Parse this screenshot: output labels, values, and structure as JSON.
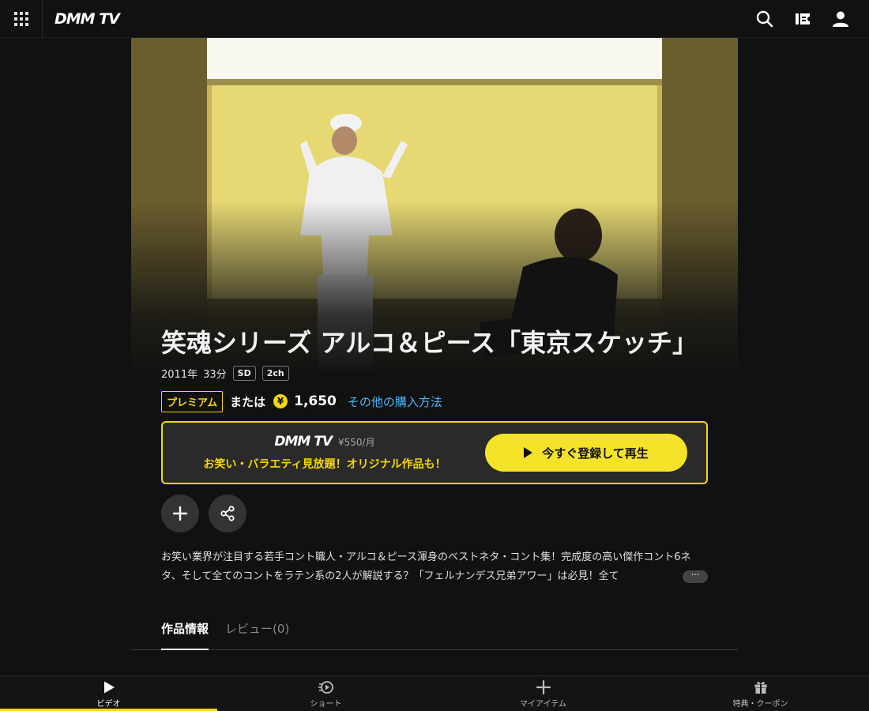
{
  "header": {
    "logo": "DMM TV",
    "icons": [
      "apps-grid-icon",
      "search-icon",
      "ticket-icon",
      "account-icon"
    ]
  },
  "work": {
    "title": "笑魂シリーズ アルコ＆ピース「東京スケッチ」",
    "year": "2011年",
    "duration": "33分",
    "tags": [
      "SD",
      "2ch"
    ],
    "premium_badge": "プレミアム",
    "or_text": "または",
    "yen_symbol": "¥",
    "price": "1,650",
    "other_purchase_link": "その他の購入方法",
    "description": "お笑い業界が注目する若手コント職人・アルコ＆ピース渾身のベストネタ・コント集！完成度の高い傑作コント6ネタ、そして全てのコントをラテン系の2人が解説する？「フェルナンデス兄弟アワー」は必見！全て",
    "more_label": "···"
  },
  "promo": {
    "logo": "DMM TV",
    "price": "¥550/月",
    "copy": "お笑い・バラエティ見放題！オリジナル作品も！",
    "cta_label": "今すぐ登録して再生"
  },
  "tabs": [
    {
      "label": "作品情報",
      "active": true
    },
    {
      "label": "レビュー(0)",
      "active": false
    }
  ],
  "bottom_nav": [
    {
      "label": "ビデオ",
      "icon": "play-icon",
      "active": true
    },
    {
      "label": "ショート",
      "icon": "short-play-icon",
      "active": false
    },
    {
      "label": "マイアイテム",
      "icon": "plus-icon",
      "active": false
    },
    {
      "label": "特典・クーポン",
      "icon": "gift-icon",
      "active": false
    }
  ],
  "colors": {
    "accent_yellow": "#f5d70b",
    "cta_yellow": "#f5e32a",
    "link_blue": "#4ab7ff",
    "background": "#111111"
  }
}
